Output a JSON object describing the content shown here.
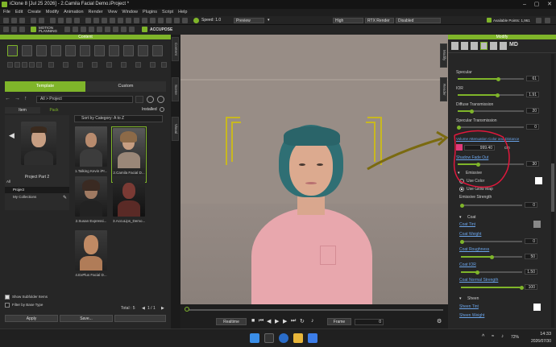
{
  "window": {
    "title": "iClone 8 [Jul 25 2026] - 2.Camila Facial Demo.iProject *"
  },
  "menu": [
    "File",
    "Edit",
    "Create",
    "Modify",
    "Animation",
    "Render",
    "View",
    "Window",
    "Plugins",
    "Script",
    "Help"
  ],
  "toolbar": {
    "speed_label": "Speed: 1.0",
    "preview": "Preview",
    "quality": "High",
    "rtx": "RTX Render",
    "disabled": "Disabled",
    "points": "Available Points: 1,961"
  },
  "toolbar2": {
    "motion_planning": "MOTION PLANNING",
    "accupose": "ACCUPOSE"
  },
  "content": {
    "header": "Content",
    "tabs": {
      "template": "Template",
      "custom": "Custom"
    },
    "path": "All > Project",
    "subtabs": {
      "item": "Item",
      "pack": "Pack",
      "installed": "Installed"
    },
    "sort": "Sort by Category: A to Z",
    "preview_label": "Project Part 2",
    "tree": [
      "All",
      "Project",
      "My Collections"
    ],
    "items": [
      "1.Talking Kevin iPr...",
      "2.Camila Facial D...",
      "2.Susan Expressi...",
      "3.AccuLips_Demo...",
      "4.ExPlus Facial D..."
    ],
    "show_subfolder": "Show Subfolder Items",
    "filter_base": "Filter by Base Type",
    "total": "Total : 5",
    "page": "1 / 1",
    "apply": "Apply",
    "save": "Save..."
  },
  "sidetabs": [
    "Content",
    "Scene",
    "Visual"
  ],
  "righttabs": [
    "Modify",
    "Render"
  ],
  "modify": {
    "header": "Modify",
    "specular": "Specular",
    "specular_val": "61",
    "ior": "IOR",
    "ior_val": "1.91",
    "diffuse_trans": "Diffuse Transmission",
    "diffuse_val": "20",
    "spec_trans": "Specular Transmission",
    "spec_trans_val": "0",
    "volume_attn": "Volume Attenuation Color and Distance",
    "distance_val": "999.40",
    "distance_unit": "cm",
    "shadow_fade": "Shadow Fade Out",
    "shadow_val": "30",
    "emissive": "Emissive",
    "use_color": "Use Color",
    "use_glow": "Use Glow Map",
    "emissive_strength": "Emissive Strength",
    "emissive_val": "0",
    "coat": "Coat",
    "coat_tint": "Coat Tint",
    "coat_weight": "Coat Weight",
    "coat_weight_val": "0",
    "coat_roughness": "Coat Roughness",
    "coat_roughness_val": "50",
    "coat_ior": "Coat IOR",
    "coat_ior_val": "1.50",
    "coat_normal": "Coat Normal Strength",
    "coat_normal_val": "100",
    "sheen": "Sheen",
    "sheen_tint": "Sheen Tint",
    "sheen_weight": "Sheen Weight"
  },
  "timeline": {
    "realtime": "Realtime",
    "frame": "Frame",
    "frame_val": "0"
  },
  "taskbar": {
    "time": "14:33",
    "date": "2026/07/30",
    "battery": "72%"
  },
  "colors": {
    "accent": "#7fb52a",
    "annotation": "#e0183c",
    "arrow": "#7a6a10"
  }
}
